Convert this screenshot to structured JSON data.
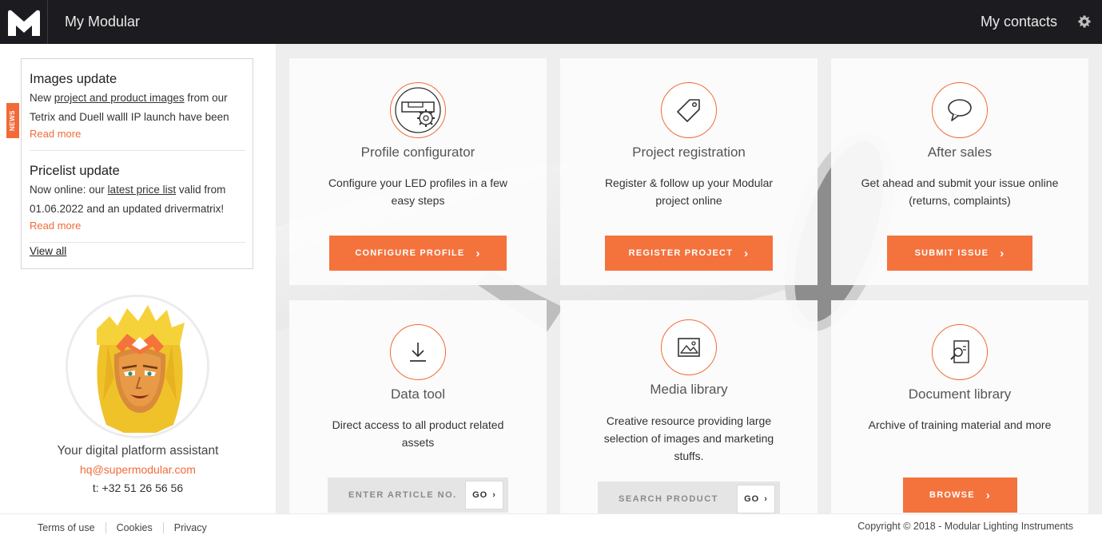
{
  "header": {
    "app_title": "My Modular",
    "contacts_label": "My contacts",
    "logo_icon": "modular-m-logo",
    "settings_icon": "gear-icon"
  },
  "news": {
    "tab_label": "NEWS",
    "items": [
      {
        "title": "Images update",
        "text_before": "New ",
        "link": "project and product images",
        "text_after": " from our Tetrix and Duell walll IP launch have been",
        "read_more": "Read more"
      },
      {
        "title": "Pricelist update",
        "text_before": "Now online: our ",
        "link": "latest price list",
        "text_after": " valid from 01.06.2022 and an updated drivermatrix!",
        "read_more": "Read more"
      }
    ],
    "view_all": "View all"
  },
  "assistant": {
    "label": "Your digital platform assistant",
    "email": "hq@supermodular.com",
    "phone": "t: +32 51 26 56 56"
  },
  "cards": [
    {
      "title": "Profile configurator",
      "desc": "Configure your LED profiles in a few easy steps",
      "button": "CONFIGURE PROFILE",
      "icon": "profile-gear-icon"
    },
    {
      "title": "Project registration",
      "desc": "Register & follow up your Modular project online",
      "button": "REGISTER PROJECT",
      "icon": "tag-icon"
    },
    {
      "title": "After sales",
      "desc": "Get ahead and submit your issue online (returns, complaints)",
      "button": "SUBMIT ISSUE",
      "icon": "speech-bubble-icon"
    },
    {
      "title": "Data tool",
      "desc": "Direct access to all product related assets",
      "search_placeholder": "ENTER ARTICLE NO.",
      "go": "GO",
      "icon": "download-icon"
    },
    {
      "title": "Media library",
      "desc": "Creative resource providing large selection of images and marketing stuffs.",
      "search_placeholder": "SEARCH PRODUCT",
      "go": "GO",
      "icon": "image-icon"
    },
    {
      "title": "Document library",
      "desc": "Archive of training material and more",
      "button": "BROWSE",
      "icon": "document-search-icon"
    }
  ],
  "footer": {
    "links": [
      "Terms of use",
      "Cookies",
      "Privacy"
    ],
    "copyright": "Copyright © 2018 - Modular Lighting Instruments"
  },
  "colors": {
    "accent": "#f4733d",
    "header_bg": "#1c1c20"
  }
}
